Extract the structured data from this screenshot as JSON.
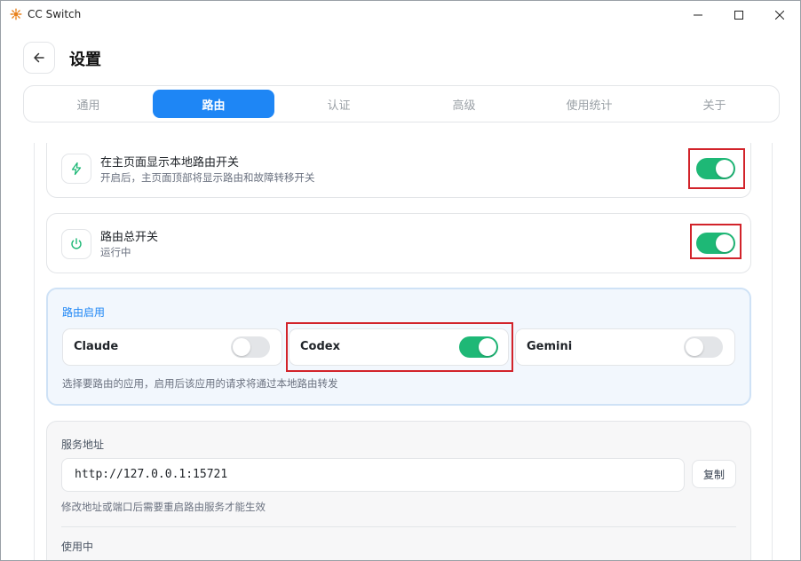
{
  "window": {
    "title": "CC Switch"
  },
  "header": {
    "title": "设置"
  },
  "tabs": [
    {
      "label": "通用",
      "active": false
    },
    {
      "label": "路由",
      "active": true
    },
    {
      "label": "认证",
      "active": false
    },
    {
      "label": "高级",
      "active": false
    },
    {
      "label": "使用统计",
      "active": false
    },
    {
      "label": "关于",
      "active": false
    }
  ],
  "settings": {
    "show_switch": {
      "title": "在主页面显示本地路由开关",
      "description": "开启后，主页面顶部将显示路由和故障转移开关",
      "enabled": true,
      "icon": "lightning-icon"
    },
    "master_switch": {
      "title": "路由总开关",
      "status": "运行中",
      "enabled": true,
      "icon": "power-icon"
    }
  },
  "routing": {
    "label": "路由启用",
    "apps": [
      {
        "name": "Claude",
        "enabled": false
      },
      {
        "name": "Codex",
        "enabled": true
      },
      {
        "name": "Gemini",
        "enabled": false
      }
    ],
    "hint": "选择要路由的应用，启用后该应用的请求将通过本地路由转发"
  },
  "service": {
    "label": "服务地址",
    "address": "http://127.0.0.1:15721",
    "copy_label": "复制",
    "hint": "修改地址或端口后需要重启路由服务才能生效",
    "in_use_label": "使用中"
  },
  "colors": {
    "accent": "#1e86f5",
    "toggle_on": "#1eb876",
    "highlight": "#d2232a"
  }
}
